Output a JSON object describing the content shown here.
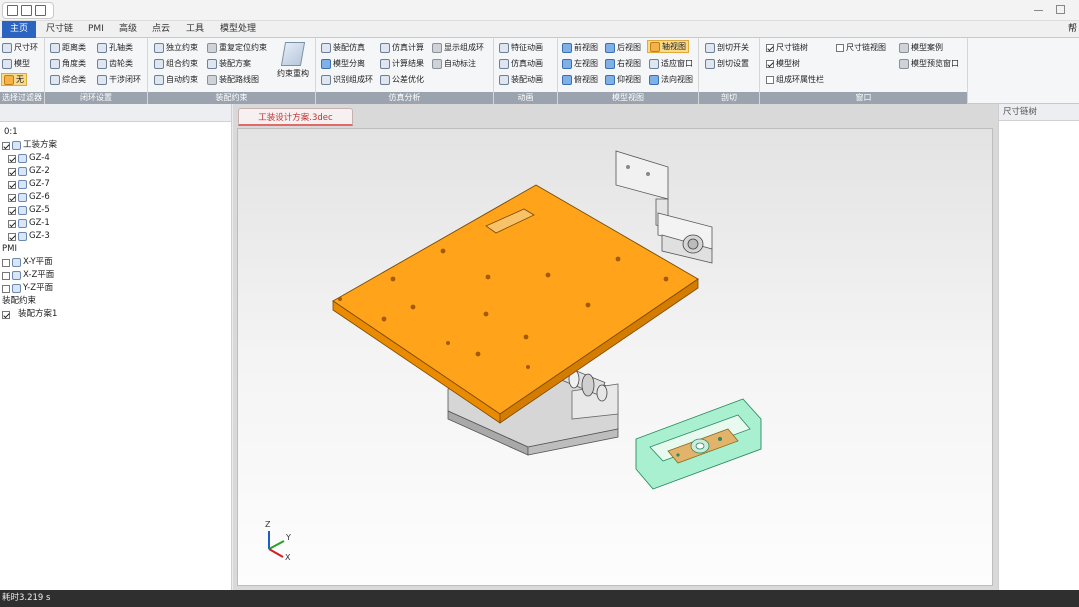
{
  "colors": {
    "accent": "#2a64c0",
    "plate": "#ffa31a",
    "highlight": "#a8f0cf",
    "group_label_bg": "#9aa3ae",
    "statusbar_bg": "#2f2f2f"
  },
  "tabs": [
    "主页",
    "尺寸链",
    "PMI",
    "高级",
    "点云",
    "工具",
    "模型处理"
  ],
  "tab_right": "帮",
  "ribbon": {
    "sel": {
      "label": "选择过滤器",
      "chain": "尺寸环",
      "model": "模型",
      "none": "无"
    },
    "loop": {
      "label": "闭环设置",
      "distance": "距离类",
      "angle": "角度类",
      "combo": "综合类",
      "hole_shaft": "孔轴类",
      "gear": "齿轮类",
      "interference": "干涉闭环"
    },
    "constraint": {
      "label": "装配约束",
      "independent": "独立约束",
      "combined": "组合约束",
      "auto": "自动约束",
      "relocate": "重复定位约束",
      "assembly_plan": "装配方案",
      "assembly_path": "装配路线图",
      "rebuild": "约束重构"
    },
    "sim": {
      "label": "仿真分析",
      "assembly_sim": "装配仿真",
      "model_split": "模型分离",
      "identify_loop": "识别组成环",
      "sim_calc": "仿真计算",
      "calc_result": "计算结果",
      "tol_opt": "公差优化",
      "show_loop": "显示组成环",
      "auto_mark": "自动标注"
    },
    "anim": {
      "label": "动画",
      "feature_anim": "特征动画",
      "sim_anim": "仿真动画",
      "assembly_anim": "装配动画"
    },
    "view": {
      "label": "模型视图",
      "front": "前视图",
      "left": "左视图",
      "top": "俯视图",
      "back": "后视图",
      "right": "右视图",
      "bottom": "仰视图",
      "axis": "轴视图",
      "fit": "适应窗口",
      "normal": "法向视图"
    },
    "section": {
      "label": "剖切",
      "toggle": "剖切开关",
      "settings": "剖切设置"
    },
    "window": {
      "label": "窗口",
      "chain_tree": "尺寸链树",
      "model_tree": "模型树",
      "loop_attr": "组成环属性栏",
      "chain_view": "尺寸链视图",
      "model_case": "模型案例",
      "model_browse": "模型预览窗口"
    }
  },
  "tree": {
    "root": "0:1",
    "fixture": "工装方案",
    "parts": [
      "GZ-4",
      "GZ-2",
      "GZ-7",
      "GZ-6",
      "GZ-5",
      "GZ-1",
      "GZ-3"
    ],
    "pmi": "PMI",
    "planes": [
      "X-Y平面",
      "X-Z平面",
      "Y-Z平面"
    ],
    "constraint": "装配约束",
    "plan": "装配方案1"
  },
  "right_panel_title": "尺寸链树",
  "doc_tab": "工装设计方案.3dec",
  "axis": {
    "x": "X",
    "y": "Y",
    "z": "Z"
  },
  "status": "耗时3.219 s"
}
